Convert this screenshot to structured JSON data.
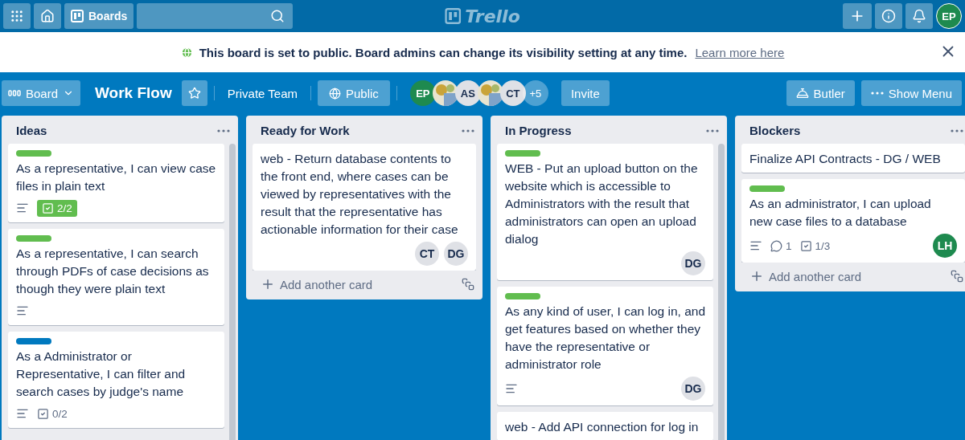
{
  "topbar": {
    "boards_label": "Boards",
    "logo": "Trello",
    "user": {
      "initials": "EP",
      "color": "#1e8a4f"
    }
  },
  "banner": {
    "message": "This board is set to public. Board admins can change its visibility setting at any time.",
    "link": "Learn more here"
  },
  "board_header": {
    "view": "Board",
    "title": "Work Flow",
    "starred": false,
    "team": "Private Team",
    "visibility": "Public",
    "members": [
      {
        "kind": "initials",
        "initials": "EP",
        "color": "#1e8a4f"
      },
      {
        "kind": "picture"
      },
      {
        "kind": "initials",
        "initials": "AS",
        "color": "#dfe1e6"
      },
      {
        "kind": "picture"
      },
      {
        "kind": "initials",
        "initials": "CT",
        "color": "#dfe1e6"
      }
    ],
    "more_members": "+5",
    "invite": "Invite",
    "butler": "Butler",
    "menu": "Show Menu"
  },
  "lists": [
    {
      "title": "Ideas",
      "scrollbar": true,
      "cards": [
        {
          "color": "#61bd4f",
          "text": "As a representative, I can view case files in plain text",
          "description": true,
          "checklist": {
            "text": "2/2",
            "complete": true
          }
        },
        {
          "color": "#61bd4f",
          "text": "As a representative, I can search through PDFs of case decisions as though they were plain text",
          "description": true
        },
        {
          "color": "#0079bf",
          "text": "As a Administrator or Representative, I can filter and search cases by judge's name",
          "description": true,
          "checklist": {
            "text": "0/2",
            "complete": false
          }
        }
      ]
    },
    {
      "title": "Ready for Work",
      "scrollbar": false,
      "add_card": "Add another card",
      "cards": [
        {
          "text": "web - Return database contents to the front end, where cases can be viewed by representatives with the result that the representative has actionable information for their case",
          "description": false,
          "members": [
            {
              "initials": "CT",
              "color": "#dfe1e6"
            },
            {
              "initials": "DG",
              "color": "#dfe1e6"
            }
          ]
        }
      ]
    },
    {
      "title": "In Progress",
      "scrollbar": true,
      "cards": [
        {
          "color": "#61bd4f",
          "text": "WEB - Put an upload button on the website which is accessible to Administrators with the result that administrators can open an upload dialog",
          "description": false,
          "members": [
            {
              "initials": "DG",
              "color": "#dfe1e6"
            }
          ]
        },
        {
          "color": "#61bd4f",
          "text": "As any kind of user, I can log in, and get features based on whether they have the representative or administrator role",
          "description": true,
          "members": [
            {
              "initials": "DG",
              "color": "#dfe1e6"
            }
          ]
        },
        {
          "text": "web - Add API connection for log in",
          "description": false
        }
      ]
    },
    {
      "title": "Blockers",
      "scrollbar": false,
      "add_card": "Add another card",
      "cards": [
        {
          "text": "Finalize API Contracts - DG / WEB",
          "description": false
        },
        {
          "color": "#61bd4f",
          "text": "As an administrator, I can upload new case files to a database",
          "description": true,
          "comments": "1",
          "checklist": {
            "text": "1/3",
            "complete": false
          },
          "members": [
            {
              "initials": "LH",
              "color": "#1e8a4f"
            }
          ]
        }
      ]
    }
  ]
}
